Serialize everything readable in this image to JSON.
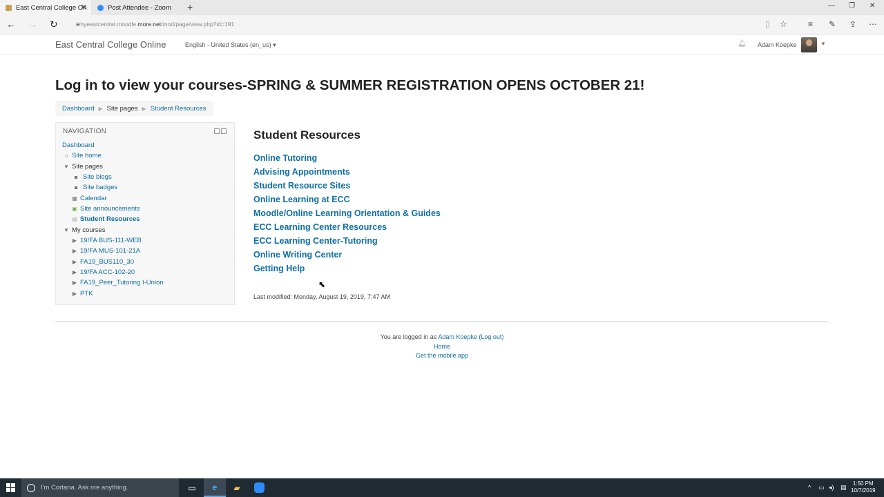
{
  "browser": {
    "tabs": [
      {
        "label": "East Central College On",
        "active": true
      },
      {
        "label": "Post Attendee - Zoom",
        "active": false
      }
    ],
    "url_prefix": "myeastcentral.moodle.",
    "url_host": "more.net",
    "url_path": "/mod/page/view.php?id=191"
  },
  "header": {
    "brand": "East Central College Online",
    "language": "English - United States (en_us) ▾",
    "user_name": "Adam Koepke"
  },
  "page": {
    "title": "Log in to view your courses-SPRING & SUMMER REGISTRATION OPENS OCTOBER 21!"
  },
  "breadcrumb": {
    "items": [
      "Dashboard",
      "Site pages",
      "Student Resources"
    ]
  },
  "navigation": {
    "heading": "NAVIGATION",
    "items": [
      {
        "label": "Dashboard"
      },
      {
        "label": "Site home"
      },
      {
        "label": "Site pages"
      },
      {
        "label": "Site blogs"
      },
      {
        "label": "Site badges"
      },
      {
        "label": "Calendar"
      },
      {
        "label": "Site announcements"
      },
      {
        "label": "Student Resources"
      },
      {
        "label": "My courses"
      },
      {
        "label": "19/FA BUS-111-WEB"
      },
      {
        "label": "19/FA MUS-101-21A"
      },
      {
        "label": "FA19_BUS110_30"
      },
      {
        "label": "19/FA ACC-102-20"
      },
      {
        "label": "FA19_Peer_Tutoring I-Union"
      },
      {
        "label": "PTK"
      }
    ]
  },
  "main": {
    "title": "Student Resources",
    "links": [
      "Online Tutoring",
      "Advising Appointments",
      "Student Resource Sites",
      "Online Learning at ECC",
      "Moodle/Online Learning Orientation & Guides",
      "ECC Learning Center Resources",
      "ECC Learning Center-Tutoring",
      "Online Writing Center",
      "Getting Help"
    ],
    "last_modified": "Last modified: Monday, August 19, 2019, 7:47 AM"
  },
  "footer": {
    "logged_in_prefix": "You are logged in as",
    "user_link": "Adam Koepke",
    "logout": "(Log out)",
    "home": "Home",
    "mobile_app": "Get the mobile app"
  },
  "taskbar": {
    "search_placeholder": "I'm Cortana. Ask me anything.",
    "time": "1:50 PM",
    "date": "10/7/2019"
  }
}
